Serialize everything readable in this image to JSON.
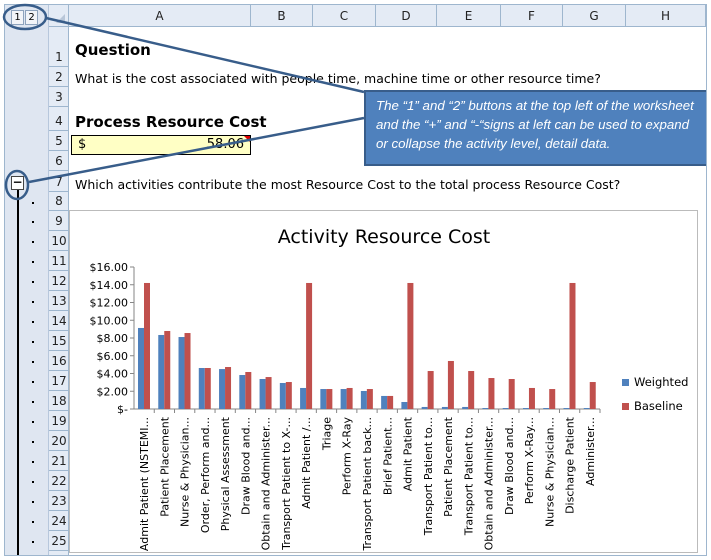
{
  "outline": {
    "levels": [
      "1",
      "2"
    ],
    "collapse_sign": "−"
  },
  "columns": [
    "A",
    "B",
    "C",
    "D",
    "E",
    "F",
    "G",
    "H"
  ],
  "rows": [
    "1",
    "2",
    "3",
    "4",
    "5",
    "6",
    "7",
    "8",
    "9",
    "10",
    "11",
    "12",
    "13",
    "14",
    "15",
    "16",
    "17",
    "18",
    "19",
    "20",
    "21",
    "22",
    "23",
    "24",
    "25"
  ],
  "cells": {
    "question_heading": "Question",
    "question_text": "What is the cost associated with people time, machine time or other resource time?",
    "cost_heading": "Process Resource Cost",
    "cost_currency": "$",
    "cost_value": "58.06",
    "activities_question": "Which activities contribute the most Resource Cost to the total process Resource Cost?"
  },
  "callout": {
    "text": "The “1” and “2” buttons at the top left of the worksheet and the “+” and “-“signs at left can be used to expand or collapse the activity level, detail data."
  },
  "colors": {
    "weighted": "#4f81bd",
    "baseline": "#c0504d",
    "callout": "#4f81bd"
  },
  "chart_data": {
    "type": "bar",
    "title": "Activity Resource Cost",
    "ylim": [
      0,
      16
    ],
    "yticks": [
      "$-",
      "$2.00",
      "$4.00",
      "$6.00",
      "$8.00",
      "$10.00",
      "$12.00",
      "$14.00",
      "$16.00"
    ],
    "legend_position": "right",
    "categories": [
      "Admit Patient (NSTEMI...",
      "Patient Placement",
      "Nurse & Physician...",
      "Order, Perform and...",
      "Physical Assessment",
      "Draw  Blood and...",
      "Obtain and Administer...",
      "Transport Patient to X-...",
      "Admit Patient /...",
      "Triage",
      "Perform X-Ray",
      "Transport Patient back...",
      "Brief Patient...",
      "Admit Patient",
      "Transport Patient to...",
      "Patient Placement",
      "Transport Patient to...",
      "Obtain and Administer...",
      "Draw  Blood and...",
      "Perform X-Ray...",
      "Nurse & Physician...",
      "Discharge Patient",
      "Administer..."
    ],
    "series": [
      {
        "name": "Weighted",
        "values": [
          9.13,
          8.34,
          8.11,
          4.62,
          4.5,
          3.83,
          3.38,
          2.93,
          2.37,
          2.25,
          2.25,
          2.03,
          1.47,
          0.79,
          0.23,
          0.23,
          0.23,
          0.11,
          0.11,
          0.11,
          0.11,
          0.11,
          0.11
        ]
      },
      {
        "name": "Baseline",
        "values": [
          14.2,
          8.79,
          8.56,
          4.62,
          4.73,
          4.17,
          3.6,
          3.04,
          14.2,
          2.25,
          2.37,
          2.25,
          1.47,
          14.2,
          4.28,
          5.41,
          4.28,
          3.49,
          3.38,
          2.37,
          2.25,
          14.2,
          3.04
        ]
      }
    ]
  }
}
